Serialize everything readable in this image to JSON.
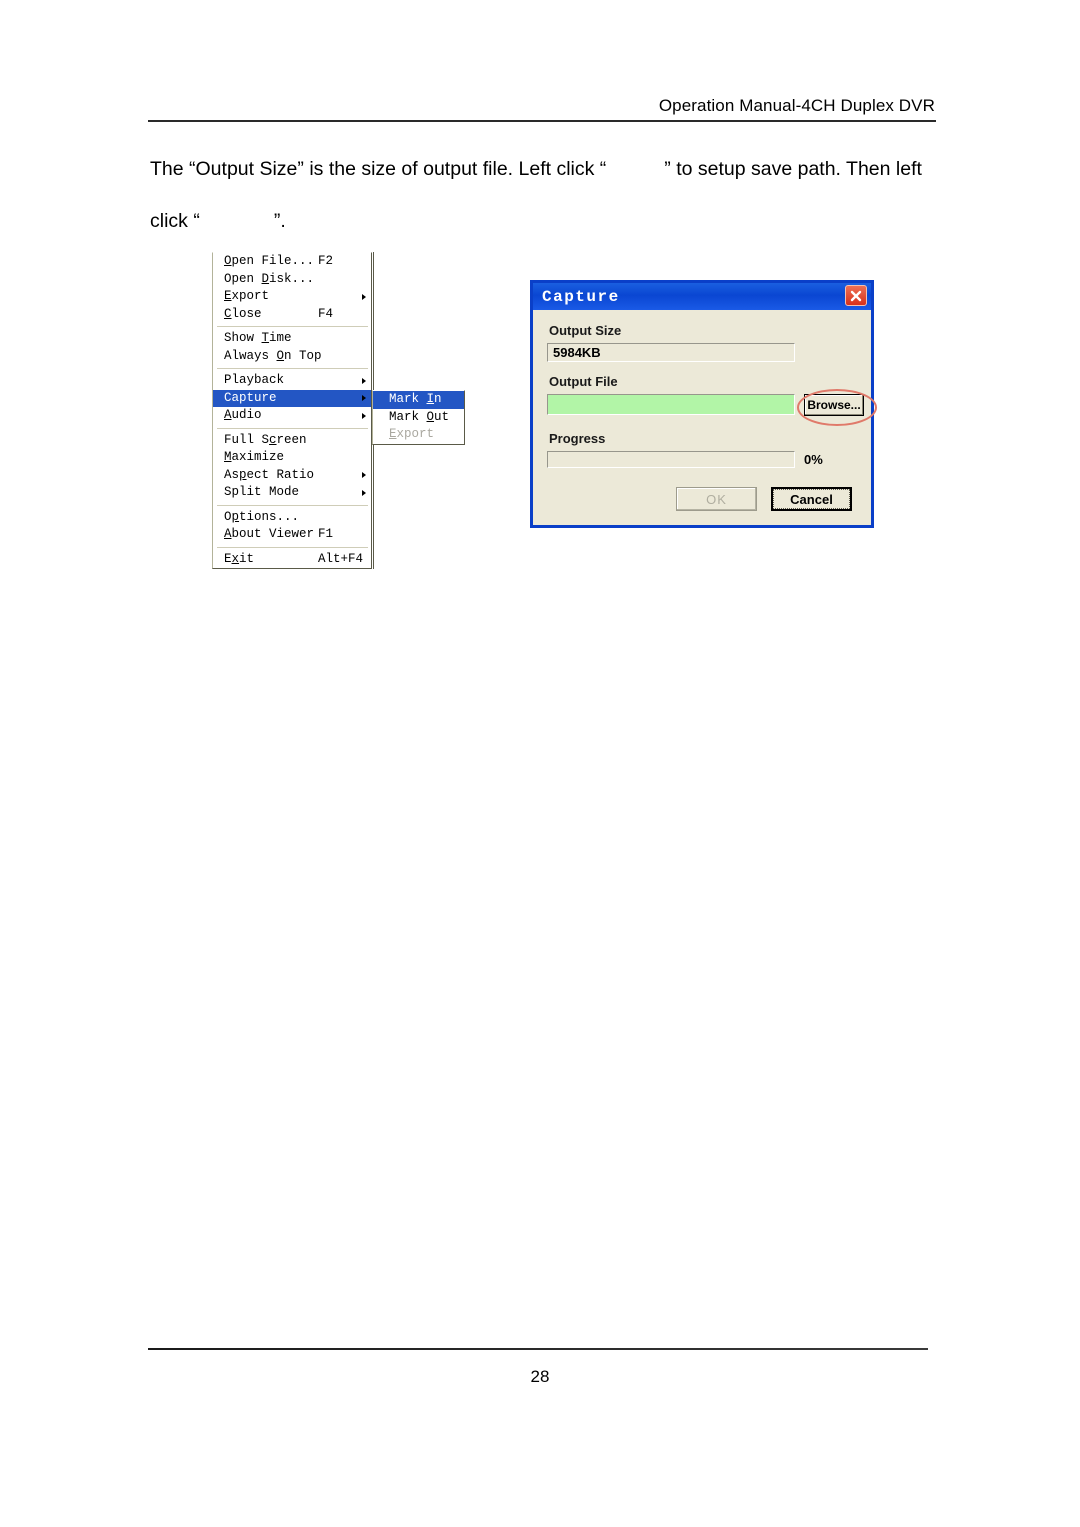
{
  "page": {
    "header": "Operation Manual-4CH Duplex DVR",
    "number": "28",
    "paragraph": {
      "part1": "The “Output Size” is the size of output file. Left click “",
      "part2": "” to setup save path. Then left",
      "part3": "click “",
      "part4": "”."
    }
  },
  "context_menu": {
    "items": [
      {
        "label": "Open File...",
        "accel": "F2",
        "mnemonic": "O",
        "arrow": false,
        "state": "normal"
      },
      {
        "label": "Open Disk...",
        "accel": "",
        "mnemonic": "D",
        "arrow": false,
        "state": "normal"
      },
      {
        "label": "Export",
        "accel": "",
        "mnemonic": "E",
        "arrow": true,
        "state": "normal"
      },
      {
        "label": "Close",
        "accel": "F4",
        "mnemonic": "C",
        "arrow": false,
        "state": "normal"
      },
      {
        "separator": true
      },
      {
        "label": "Show Time",
        "accel": "",
        "mnemonic": "T",
        "arrow": false,
        "state": "normal"
      },
      {
        "label": "Always On Top",
        "accel": "",
        "mnemonic": "O",
        "arrow": false,
        "state": "normal"
      },
      {
        "separator": true
      },
      {
        "label": "Playback",
        "accel": "",
        "mnemonic": "",
        "arrow": true,
        "state": "normal"
      },
      {
        "label": "Capture",
        "accel": "",
        "mnemonic": "",
        "arrow": true,
        "state": "highlighted"
      },
      {
        "label": "Audio",
        "accel": "",
        "mnemonic": "A",
        "arrow": true,
        "state": "normal"
      },
      {
        "separator": true
      },
      {
        "label": "Full Screen",
        "accel": "",
        "mnemonic": "c",
        "arrow": false,
        "state": "normal"
      },
      {
        "label": "Maximize",
        "accel": "",
        "mnemonic": "M",
        "arrow": false,
        "state": "normal"
      },
      {
        "label": "Aspect Ratio",
        "accel": "",
        "mnemonic": "p",
        "arrow": true,
        "state": "normal"
      },
      {
        "label": "Split Mode",
        "accel": "",
        "mnemonic": "",
        "arrow": true,
        "state": "normal"
      },
      {
        "separator": true
      },
      {
        "label": "Options...",
        "accel": "",
        "mnemonic": "p",
        "arrow": false,
        "state": "normal"
      },
      {
        "label": "About Viewer",
        "accel": "F1",
        "mnemonic": "A",
        "arrow": false,
        "state": "normal"
      },
      {
        "separator": true
      },
      {
        "label": "Exit",
        "accel": "Alt+F4",
        "mnemonic": "x",
        "arrow": false,
        "state": "normal"
      }
    ]
  },
  "submenu": {
    "items": [
      {
        "label": "Mark In",
        "state": "highlighted"
      },
      {
        "label": "Mark Out",
        "state": "normal"
      },
      {
        "label": "Export",
        "state": "disabled"
      }
    ]
  },
  "dialog": {
    "title": "Capture",
    "close_icon": "close-x-icon",
    "output_size": {
      "label": "Output Size",
      "value": "5984KB"
    },
    "output_file": {
      "label": "Output File",
      "value": "",
      "placeholder": ""
    },
    "browse_label": "Browse...",
    "progress": {
      "label": "Progress",
      "percent_text": "0%",
      "percent_value": 0
    },
    "ok_label": "OK",
    "cancel_label": "Cancel"
  },
  "colors": {
    "titlebar_blue": "#0a46d2",
    "dialog_face": "#ece9d8",
    "highlight_blue": "#2356c4",
    "output_file_green": "#b2f5a7",
    "annotation_red": "#e07a6a",
    "close_red": "#d8301a"
  }
}
